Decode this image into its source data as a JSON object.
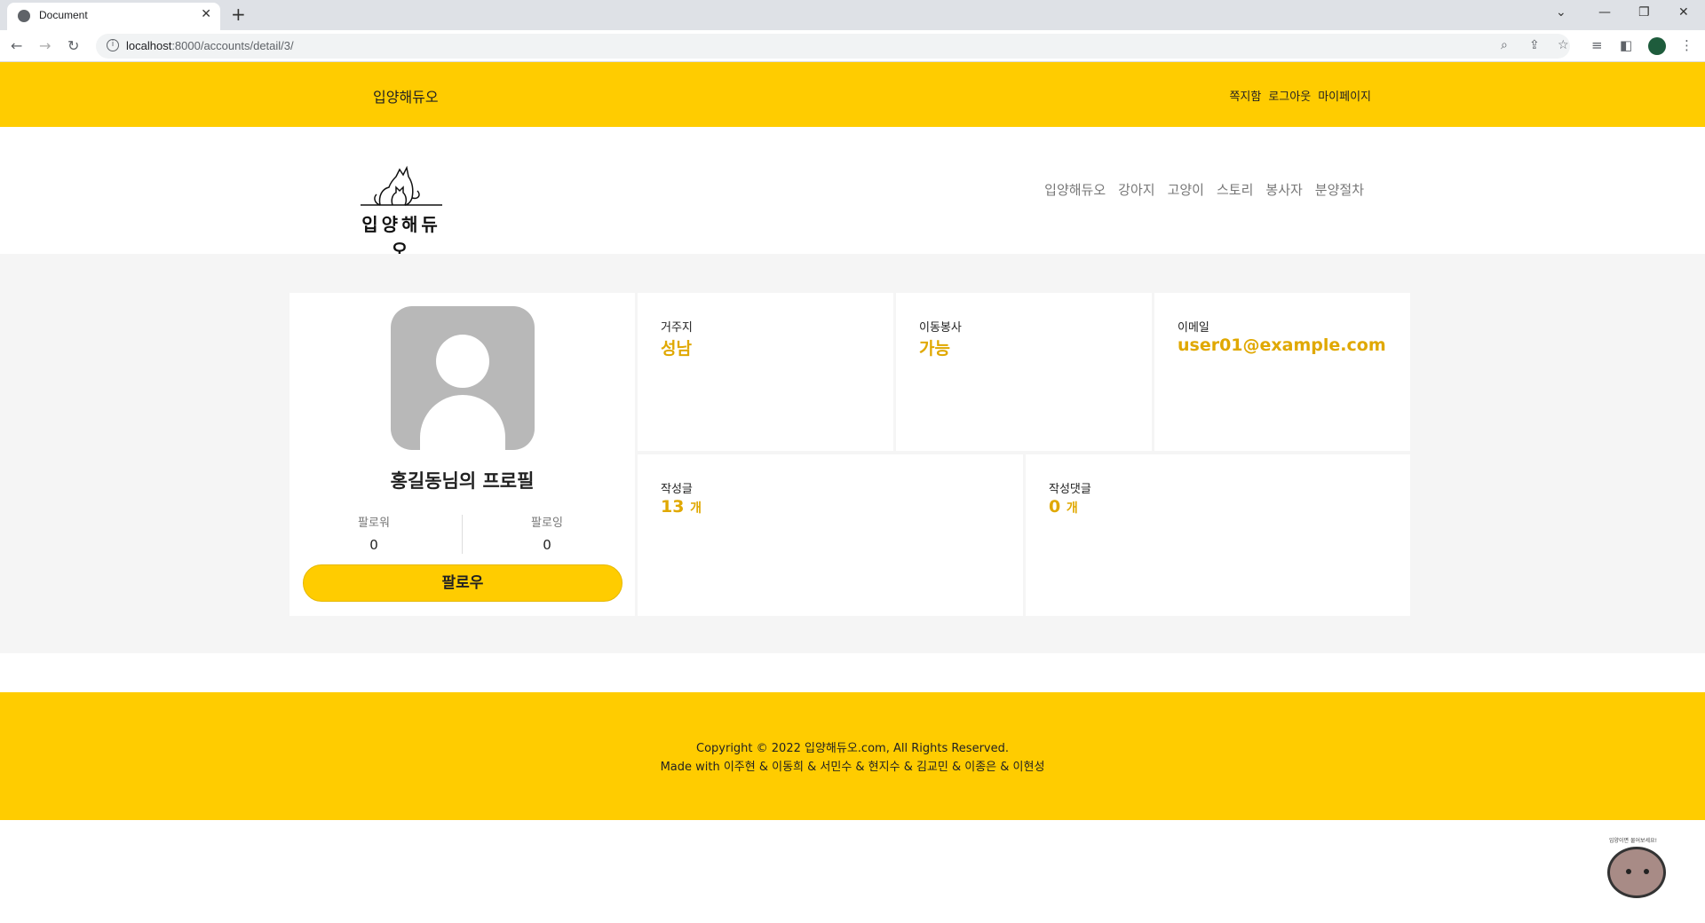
{
  "browser": {
    "tab_title": "Document",
    "url_host": "localhost",
    "url_rest": ":8000/accounts/detail/3/"
  },
  "topbar": {
    "brand": "입양해듀오",
    "links": [
      "쪽지함",
      "로그아웃",
      "마이페이지"
    ]
  },
  "header": {
    "logo_text": "입양해듀오",
    "nav": [
      "입양해듀오",
      "강아지",
      "고양이",
      "스토리",
      "봉사자",
      "분양절차"
    ]
  },
  "profile": {
    "name": "홍길동님의 프로필",
    "follower_label": "팔로워",
    "follower_count": "0",
    "following_label": "팔로잉",
    "following_count": "0",
    "follow_button": "팔로우"
  },
  "info": {
    "residence_label": "거주지",
    "residence_value": "성남",
    "transport_label": "이동봉사",
    "transport_value": "가능",
    "email_label": "이메일",
    "email_value": "user01@example.com",
    "posts_label": "작성글",
    "posts_value": "13",
    "posts_unit": "개",
    "comments_label": "작성댓글",
    "comments_value": "0",
    "comments_unit": "개"
  },
  "footer": {
    "copyright": "Copyright © 2022 입양해듀오.com, All Rights Reserved.",
    "made_with": "Made with 이주현 & 이동희 & 서민수 & 현지수 & 김교민 & 이종은 & 이현성"
  },
  "widget": {
    "bubble_text": "입양이면 물어보세요!"
  },
  "colors": {
    "accent": "#ffcc00",
    "value_text": "#e0a800",
    "content_bg": "#f5f5f5"
  }
}
